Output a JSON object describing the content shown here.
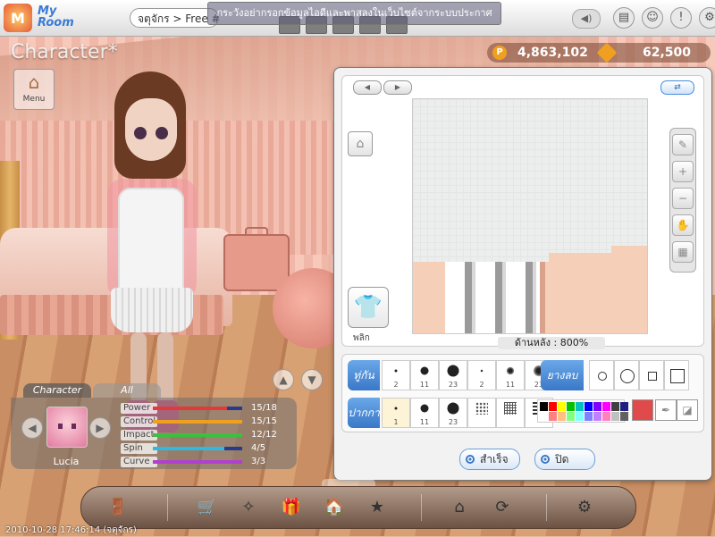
{
  "topbar": {
    "logo_text": "M",
    "myroom_line1": "My",
    "myroom_line2": "Room",
    "channel": "จตุจักร > Free #1",
    "marquee": "กระวังอย่ากรอกข้อมูลไอดีและพาสลงในเว็บไซต์จากระบบประกาศ",
    "volume_icon": "speaker-icon",
    "icons": [
      "book-icon",
      "settings-user-icon",
      "info-icon",
      "gear-icon"
    ]
  },
  "money": {
    "coins": "4,863,102",
    "gems": "62,500",
    "coin_glyph": "P"
  },
  "left": {
    "section_title": "Character*",
    "menu_label": "Menu"
  },
  "tabs": {
    "character": "Character",
    "all": "All"
  },
  "character": {
    "name": "Lucia",
    "stats": [
      {
        "label": "Power",
        "value": "15/18",
        "fraction": 0.83,
        "color": "#e03a3a"
      },
      {
        "label": "Control",
        "value": "15/15",
        "fraction": 1.0,
        "color": "#f0a020"
      },
      {
        "label": "Impact",
        "value": "12/12",
        "fraction": 1.0,
        "color": "#3cc040"
      },
      {
        "label": "Spin",
        "value": "4/5",
        "fraction": 0.8,
        "color": "#30b8e0"
      },
      {
        "label": "Curve",
        "value": "3/3",
        "fraction": 1.0,
        "color": "#b040d0"
      }
    ]
  },
  "editor": {
    "flip_label": "พลิก",
    "zoom_label": "ด้านหลัง : 800%",
    "brush_label": "ทู่กัน",
    "stamp_label": "ปากกา",
    "eraser_label": "ยางลบ",
    "brush_sizes": [
      "2",
      "11",
      "23",
      "2",
      "11",
      "23"
    ],
    "pen_sizes": [
      "1",
      "11",
      "23",
      "",
      "",
      ""
    ],
    "save_label": "สำเร็จ",
    "close_label": "ปิด",
    "palette": [
      "#000000",
      "#ff0000",
      "#ffff00",
      "#00c000",
      "#00c0c0",
      "#0000ff",
      "#8000ff",
      "#ff00ff",
      "#404040",
      "#202080",
      "#ffffff",
      "#ff8080",
      "#ffc080",
      "#80ff80",
      "#80ffff",
      "#8080ff",
      "#c080ff",
      "#ff80c0",
      "#c0c0c0",
      "#606060"
    ],
    "current_color": "#e04a4a"
  },
  "timestamp": "2010-10-28 17:46:14 (จตุจักร)"
}
